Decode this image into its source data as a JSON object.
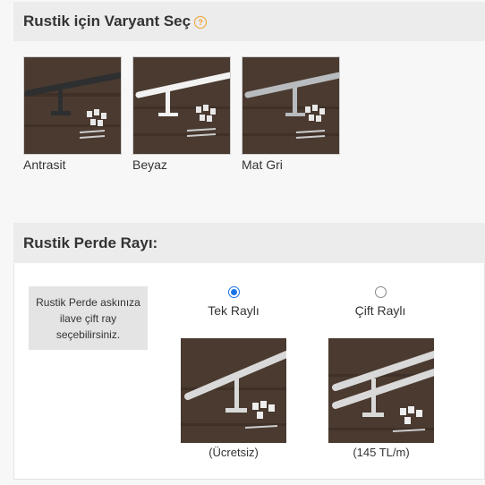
{
  "variant_section": {
    "title": "Rustik için Varyant Seç",
    "help_icon": "question-circle-icon",
    "variants": [
      {
        "label": "Antrasit",
        "color": "#3a3d40"
      },
      {
        "label": "Beyaz",
        "color": "#f2f2f2"
      },
      {
        "label": "Mat Gri",
        "color": "#b9bcbf"
      }
    ]
  },
  "rail_section": {
    "title": "Rustik Perde Rayı:",
    "info_text": "Rustik Perde askınıza ilave çift ray seçebilirsiniz.",
    "options": [
      {
        "label": "Tek Raylı",
        "price": "(Ücretsiz)",
        "selected": true
      },
      {
        "label": "Çift Raylı",
        "price": "(145 TL/m)",
        "selected": false
      }
    ]
  },
  "colors": {
    "accent": "#1a73e8",
    "help": "#f0a030",
    "header_bg": "#ececec"
  }
}
